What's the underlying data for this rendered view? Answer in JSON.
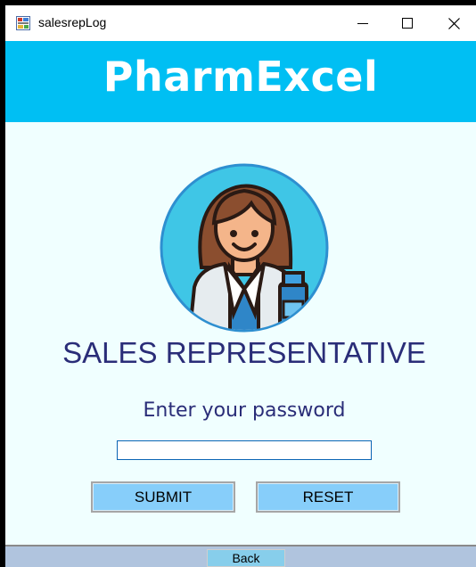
{
  "window": {
    "title": "salesrepLog",
    "icon": "form-icon"
  },
  "header": {
    "title": "PharmExcel",
    "background": "#00bff3"
  },
  "main": {
    "avatar": "pharmacist-avatar",
    "role_title": "SALES REPRESENTATIVE",
    "password_label": "Enter your password",
    "password_value": "",
    "submit_label": "SUBMIT",
    "reset_label": "RESET"
  },
  "footer": {
    "back_label": "Back"
  },
  "colors": {
    "accent": "#00bff3",
    "client_bg": "#f0ffff",
    "text": "#2a2d78",
    "button": "#87cefa",
    "footer_bg": "#b0c4de"
  }
}
